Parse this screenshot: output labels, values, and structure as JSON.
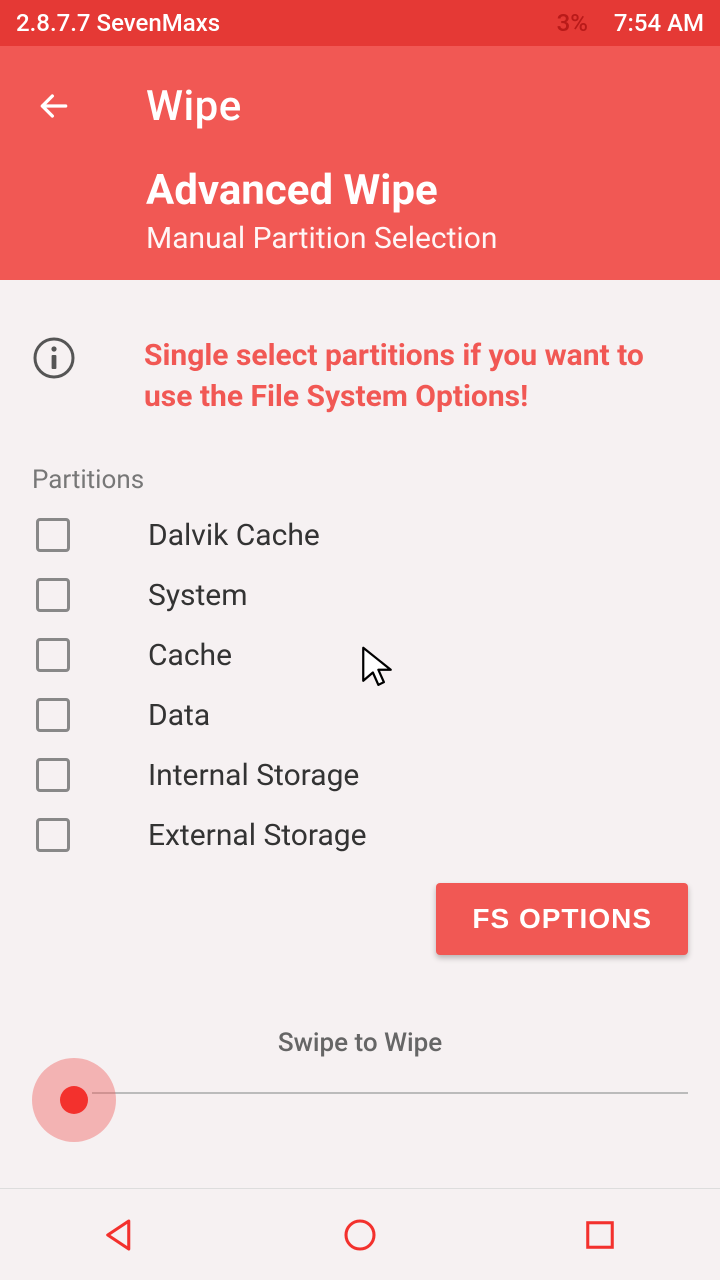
{
  "statusbar": {
    "version": "2.8.7.7 SevenMaxs",
    "battery": "3%",
    "time": "7:54 AM"
  },
  "header": {
    "title": "Wipe",
    "subtitle1": "Advanced Wipe",
    "subtitle2": "Manual Partition Selection"
  },
  "notice": "Single select partitions if you want to use the File System Options!",
  "partitions": {
    "section_label": "Partitions",
    "items": [
      {
        "label": "Dalvik Cache",
        "checked": false
      },
      {
        "label": "System",
        "checked": false
      },
      {
        "label": "Cache",
        "checked": false
      },
      {
        "label": "Data",
        "checked": false
      },
      {
        "label": "Internal Storage",
        "checked": false
      },
      {
        "label": "External Storage",
        "checked": false
      }
    ]
  },
  "buttons": {
    "fs_options": "FS OPTIONS"
  },
  "swipe": {
    "label": "Swipe to Wipe"
  }
}
